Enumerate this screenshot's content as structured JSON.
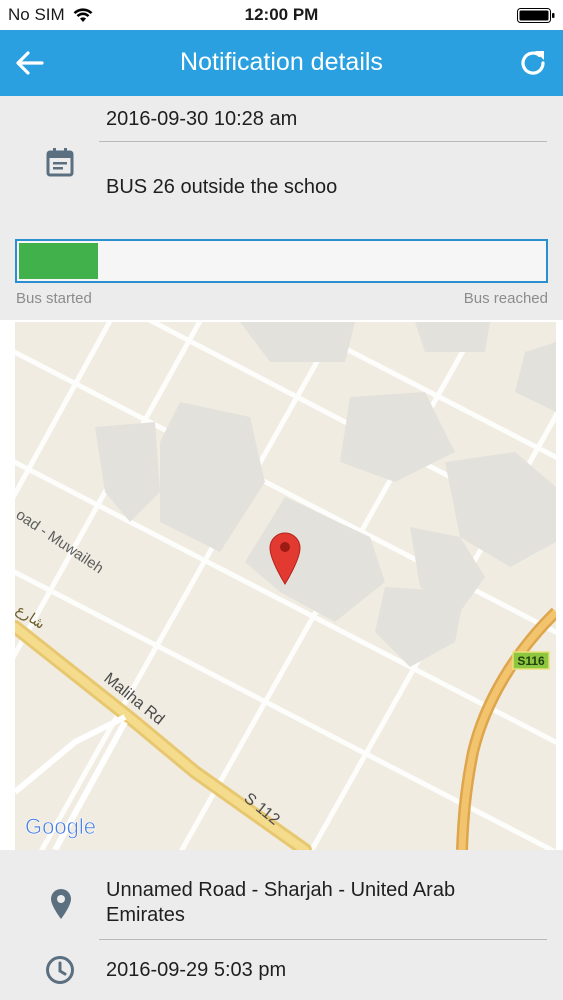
{
  "status_bar": {
    "carrier": "No SIM",
    "time": "12:00 PM"
  },
  "nav": {
    "title": "Notification details"
  },
  "notification": {
    "datetime": "2016-09-30 10:28 am",
    "message": "BUS 26 outside the schoo"
  },
  "progress": {
    "value_fraction": 0.15,
    "start_label": "Bus started",
    "end_label": "Bus reached",
    "fill_color": "#41b24b"
  },
  "map": {
    "road_labels": {
      "muwaileh": "oad - Muwaileh",
      "arabic": "شارع",
      "maliha": "Maliha Rd",
      "s112": "S 112"
    },
    "route_badge": "S116",
    "attribution": "Google"
  },
  "location": {
    "address": " Unnamed Road - Sharjah - United Arab Emirates",
    "time": "2016-09-29 5:03 pm"
  },
  "colors": {
    "accent": "#2aa0e0",
    "progress_border": "#2a8fce",
    "icon": "#5a6f80"
  }
}
